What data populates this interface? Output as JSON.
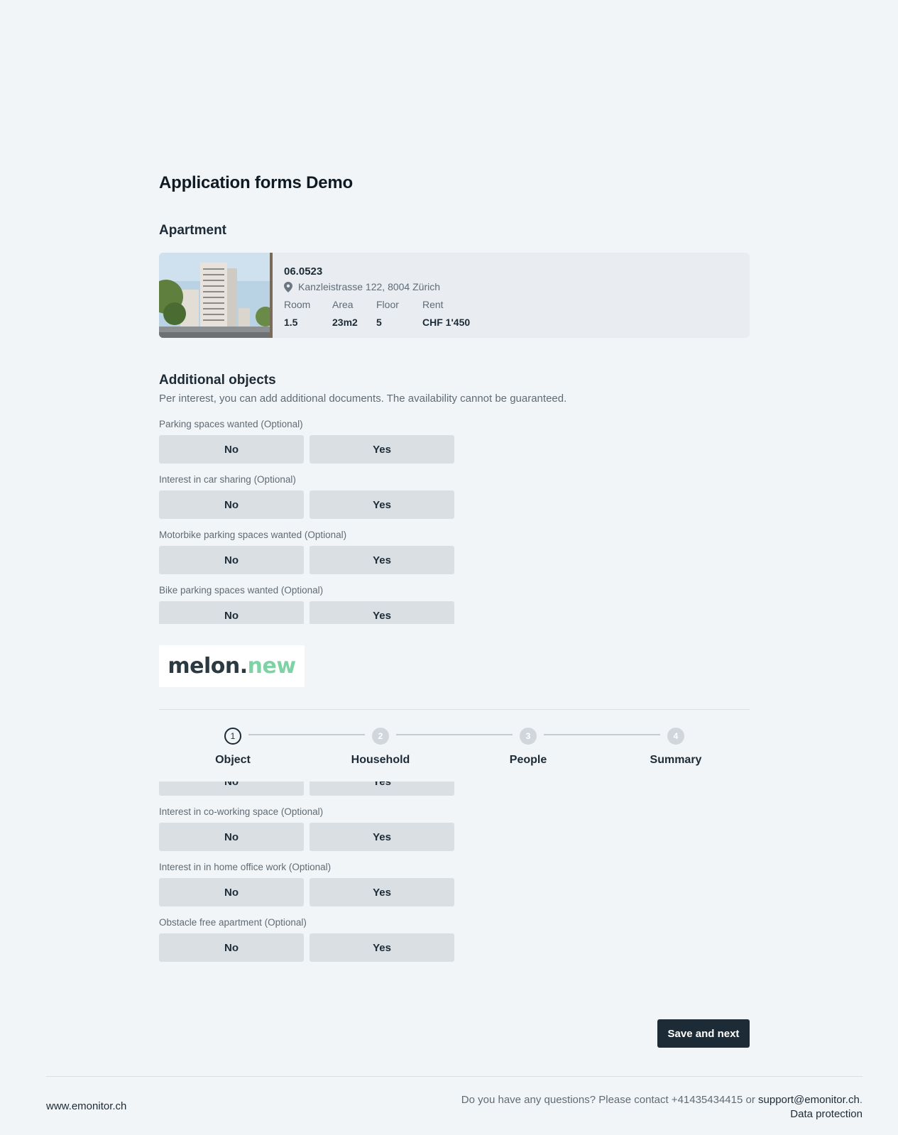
{
  "page": {
    "title": "Application forms Demo"
  },
  "apartment": {
    "section_title": "Apartment",
    "id": "06.0523",
    "address": "Kanzleistrasse 122, 8004 Zürich",
    "stats": [
      {
        "label": "Room",
        "value": "1.5"
      },
      {
        "label": "Area",
        "value": "23m2"
      },
      {
        "label": "Floor",
        "value": "5"
      },
      {
        "label": "Rent",
        "value": "CHF 1'450"
      }
    ]
  },
  "additional": {
    "section_title": "Additional objects",
    "description": "Per interest, you can add additional documents. The availability cannot be guaranteed.",
    "questions": [
      {
        "label": "Parking spaces wanted (Optional)",
        "no": "No",
        "yes": "Yes"
      },
      {
        "label": "Interest in car sharing (Optional)",
        "no": "No",
        "yes": "Yes"
      },
      {
        "label": "Motorbike parking spaces wanted (Optional)",
        "no": "No",
        "yes": "Yes"
      },
      {
        "label": "Bike parking spaces wanted (Optional)",
        "no": "No",
        "yes": "Yes"
      },
      {
        "label": "",
        "no": "No",
        "yes": "Yes"
      },
      {
        "label": "Interest in co-working space (Optional)",
        "no": "No",
        "yes": "Yes"
      },
      {
        "label": "Interest in in home office work (Optional)",
        "no": "No",
        "yes": "Yes"
      },
      {
        "label": "Obstacle free apartment (Optional)",
        "no": "No",
        "yes": "Yes"
      }
    ]
  },
  "logo": {
    "part1": "melon.",
    "part2": "new",
    "color1": "#2b3a40",
    "color2": "#7dd3a5"
  },
  "stepper": {
    "steps": [
      {
        "number": "1",
        "label": "Object",
        "active": true
      },
      {
        "number": "2",
        "label": "Household",
        "active": false
      },
      {
        "number": "3",
        "label": "People",
        "active": false
      },
      {
        "number": "4",
        "label": "Summary",
        "active": false
      }
    ]
  },
  "actions": {
    "save_next": "Save and next"
  },
  "footer": {
    "website": "www.emonitor.ch",
    "contact_text": "Do you have any questions? Please contact +41435434415 or ",
    "email": "support@emonitor.ch",
    "period": ".",
    "data_protection": "Data protection"
  },
  "colors": {
    "background": "#f2f5f8",
    "primary": "#1d2b36",
    "choice_bg": "#d9dfe3"
  }
}
